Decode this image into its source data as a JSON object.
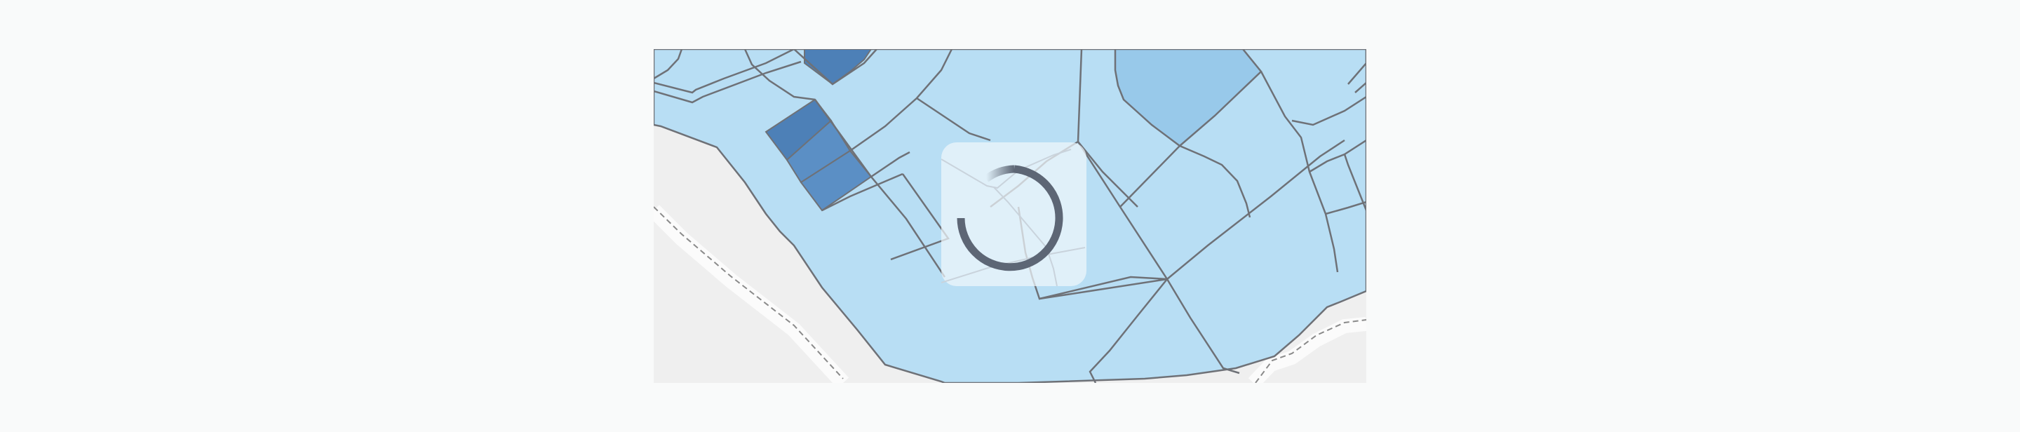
{
  "map": {
    "style": {
      "background": "#f9fafa",
      "land": "#efefef",
      "parcel_fill_light": "#b8def4",
      "parcel_fill_mid": "#98c9ea",
      "parcel_fill_dark": "#4d80b7",
      "parcel_fill_medium_dark": "#5b8fc5",
      "boundary_stroke": "#6e7177",
      "road_dashed_stroke": "#8a8a8a"
    },
    "loading": {
      "visible": true,
      "spinner_color": "#5d6675",
      "overlay_color": "#f0f6fb"
    }
  }
}
